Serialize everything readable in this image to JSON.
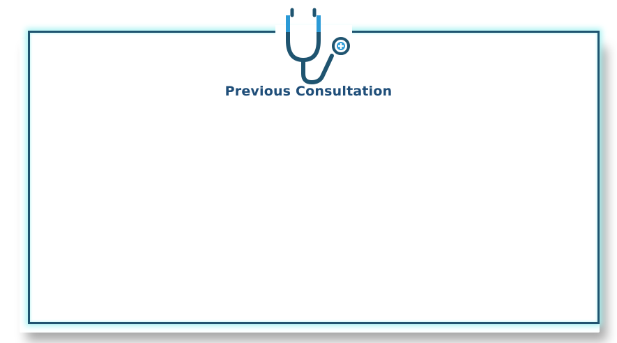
{
  "header": {
    "title": "Previous Consultation",
    "icon": "stethoscope-icon"
  },
  "colors": {
    "frame": "#1f5470",
    "glow": "#aaf3f3",
    "title": "#1f4e79",
    "icon_dark": "#1f5470",
    "icon_light": "#2b9ad6"
  }
}
